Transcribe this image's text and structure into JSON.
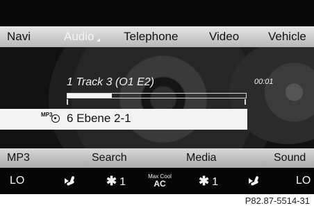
{
  "nav": {
    "items": [
      "Navi",
      "Audio",
      "Telephone",
      "Video",
      "Vehicle"
    ],
    "active_index": 1
  },
  "player": {
    "track_title": "1 Track 3 (O1 E2)",
    "elapsed": "00:01",
    "progress": 0.25,
    "selected_row": {
      "badge": "MP3",
      "text": "6 Ebene 2-1"
    }
  },
  "bottom_menu": [
    "MP3",
    "Search",
    "Media",
    "Sound"
  ],
  "climate": {
    "left_temp": "LO",
    "fan_left": "1",
    "max_cool_top": "Max Cool",
    "max_cool_bottom": "AC",
    "fan_right": "1",
    "right_temp": "LO"
  },
  "footer": {
    "code": "P82.87-5514-31"
  },
  "colors": {
    "nav_bg": "#cfcfcf",
    "active_text": "#f4f4f4",
    "selected_row_bg": "#f3f3f3",
    "bottom_bg": "#c4c4c4"
  }
}
